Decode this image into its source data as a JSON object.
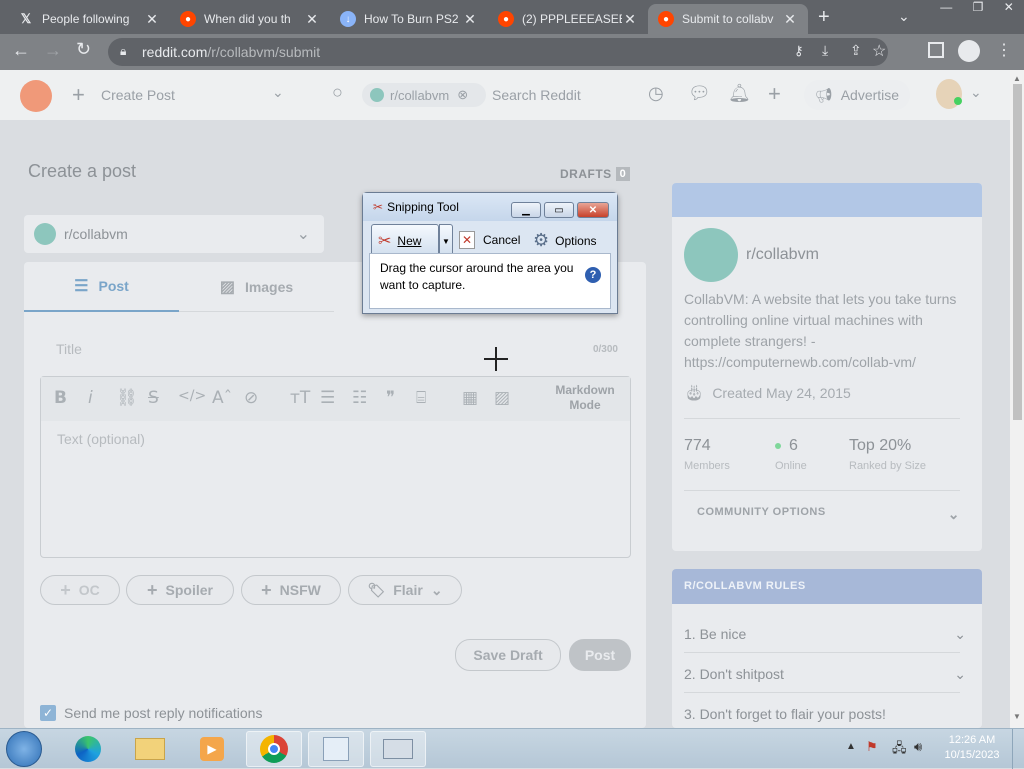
{
  "browser": {
    "tabs": [
      {
        "title": "People following",
        "icon": "x-logo-icon",
        "active": false
      },
      {
        "title": "When did you th",
        "icon": "reddit-icon",
        "active": false
      },
      {
        "title": "How To Burn PS2",
        "icon": "download-icon",
        "active": false
      },
      {
        "title": "(2) PPPLEEEASEEE",
        "icon": "reddit-icon",
        "active": false
      },
      {
        "title": "Submit to collabv",
        "icon": "reddit-icon",
        "active": true
      }
    ],
    "url_host": "reddit.com",
    "url_path": "/r/collabvm/submit"
  },
  "header": {
    "create_post": "Create Post",
    "subreddit_chip": "r/collabvm",
    "search_placeholder": "Search Reddit",
    "advertise": "Advertise"
  },
  "post_form": {
    "heading": "Create a post",
    "drafts_label": "DRAFTS",
    "drafts_count": "0",
    "community": "r/collabvm",
    "tabs": [
      "Post",
      "Images"
    ],
    "title_placeholder": "Title",
    "title_counter": "0/300",
    "markdown_mode": "Markdown\nMode",
    "text_placeholder": "Text (optional)",
    "tags": [
      "OC",
      "Spoiler",
      "NSFW",
      "Flair"
    ],
    "save_draft": "Save Draft",
    "post": "Post",
    "notify_label": "Send me post reply notifications",
    "notify_checked": true
  },
  "sidebar": {
    "community_name": "r/collabvm",
    "description": "CollabVM: A website that lets you take turns controlling online virtual machines with complete strangers! - https://computernewb.com/collab-vm/",
    "created": "Created May 24, 2015",
    "stats": [
      {
        "value": "774",
        "label": "Members"
      },
      {
        "value": "6",
        "label": "Online"
      },
      {
        "value": "Top 20%",
        "label": "Ranked by Size"
      }
    ],
    "community_options": "COMMUNITY OPTIONS",
    "rules_title": "R/COLLABVM RULES",
    "rules": [
      "1. Be nice",
      "2. Don't shitpost",
      "3. Don't forget to flair your posts!"
    ]
  },
  "snipping_tool": {
    "title": "Snipping Tool",
    "new_label": "New",
    "cancel_label": "Cancel",
    "options_label": "Options",
    "instructions": "Drag the cursor around the area you want to capture."
  },
  "taskbar": {
    "time": "12:26 AM",
    "date": "10/15/2023"
  },
  "colors": {
    "reddit_orange": "#ff4500",
    "post_blue": "#0079d3",
    "rules_header": "#a7b8d8",
    "community_banner": "#b2c7e6"
  }
}
